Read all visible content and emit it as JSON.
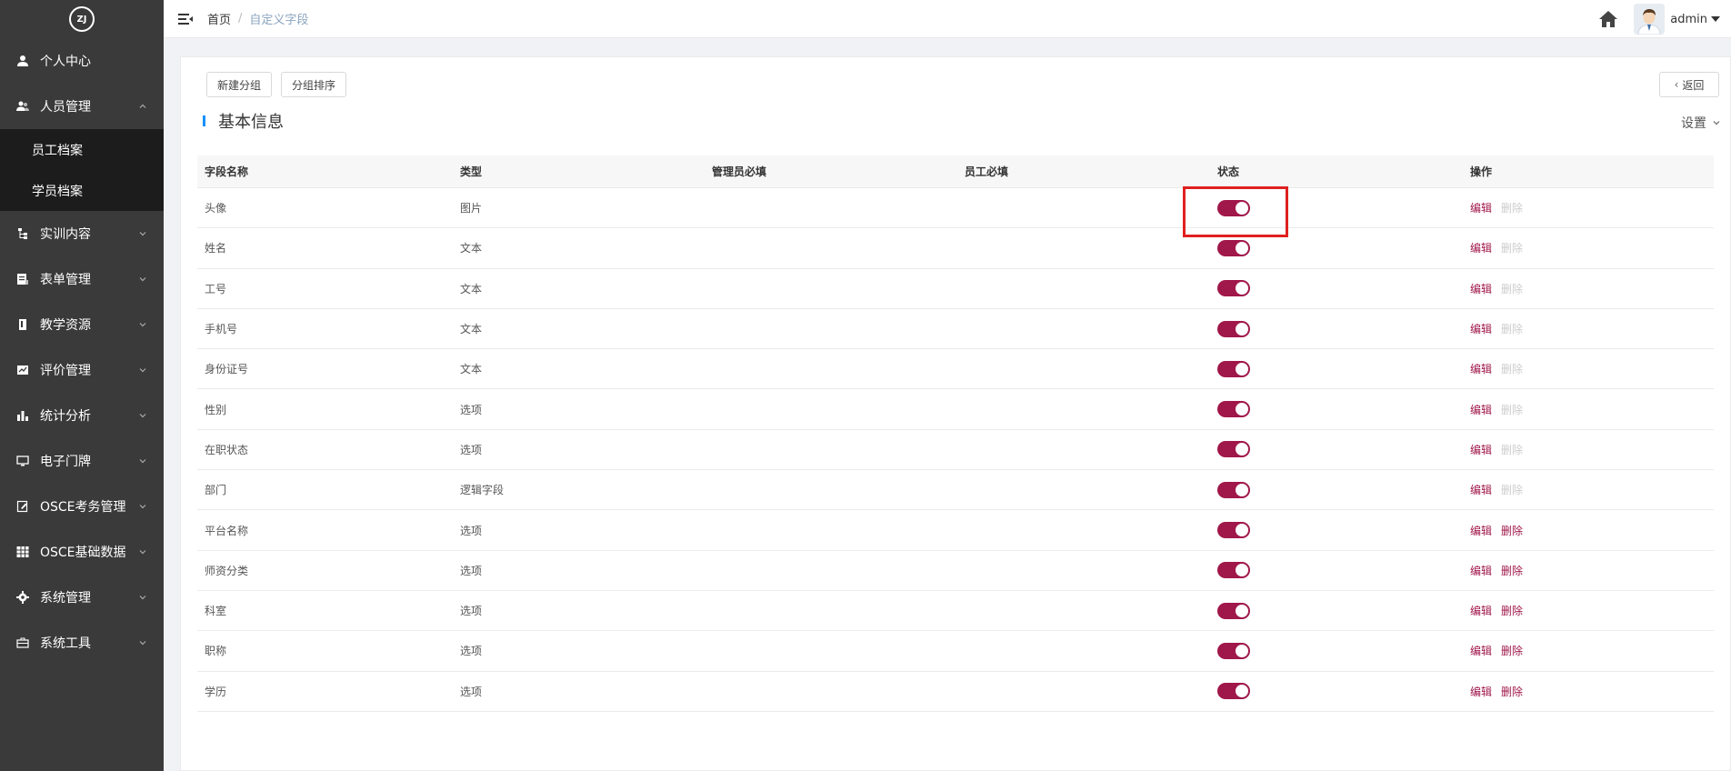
{
  "sidebar": {
    "logo": "ZJ",
    "items": [
      {
        "label": "个人中心",
        "icon": "user-icon",
        "has_children": false
      },
      {
        "label": "人员管理",
        "icon": "users-icon",
        "has_children": true,
        "expanded": true,
        "children": [
          {
            "label": "员工档案"
          },
          {
            "label": "学员档案"
          }
        ]
      },
      {
        "label": "实训内容",
        "icon": "tree-icon",
        "has_children": true
      },
      {
        "label": "表单管理",
        "icon": "form-icon",
        "has_children": true
      },
      {
        "label": "教学资源",
        "icon": "book-icon",
        "has_children": true
      },
      {
        "label": "评价管理",
        "icon": "rating-icon",
        "has_children": true
      },
      {
        "label": "统计分析",
        "icon": "bar-chart-icon",
        "has_children": true
      },
      {
        "label": "电子门牌",
        "icon": "monitor-icon",
        "has_children": true
      },
      {
        "label": "OSCE考务管理",
        "icon": "edit-icon",
        "has_children": true
      },
      {
        "label": "OSCE基础数据",
        "icon": "grid-icon",
        "has_children": true
      },
      {
        "label": "系统管理",
        "icon": "gear-icon",
        "has_children": true
      },
      {
        "label": "系统工具",
        "icon": "toolbox-icon",
        "has_children": true
      }
    ]
  },
  "header": {
    "breadcrumb": {
      "home": "首页",
      "separator": "/",
      "current": "自定义字段"
    },
    "username": "admin"
  },
  "toolbar": {
    "new_group": "新建分组",
    "sort_group": "分组排序",
    "back": "返回"
  },
  "section": {
    "title": "基本信息",
    "settings": "设置"
  },
  "table": {
    "headers": [
      "字段名称",
      "类型",
      "管理员必填",
      "员工必填",
      "状态",
      "操作"
    ],
    "edit_label": "编辑",
    "delete_label": "删除",
    "rows": [
      {
        "name": "头像",
        "type": "图片",
        "admin_required": "",
        "staff_required": "",
        "enabled": true,
        "deletable": false
      },
      {
        "name": "姓名",
        "type": "文本",
        "admin_required": "",
        "staff_required": "",
        "enabled": true,
        "deletable": false
      },
      {
        "name": "工号",
        "type": "文本",
        "admin_required": "",
        "staff_required": "",
        "enabled": true,
        "deletable": false
      },
      {
        "name": "手机号",
        "type": "文本",
        "admin_required": "",
        "staff_required": "",
        "enabled": true,
        "deletable": false
      },
      {
        "name": "身份证号",
        "type": "文本",
        "admin_required": "",
        "staff_required": "",
        "enabled": true,
        "deletable": false
      },
      {
        "name": "性别",
        "type": "选项",
        "admin_required": "",
        "staff_required": "",
        "enabled": true,
        "deletable": false
      },
      {
        "name": "在职状态",
        "type": "选项",
        "admin_required": "",
        "staff_required": "",
        "enabled": true,
        "deletable": false
      },
      {
        "name": "部门",
        "type": "逻辑字段",
        "admin_required": "",
        "staff_required": "",
        "enabled": true,
        "deletable": false
      },
      {
        "name": "平台名称",
        "type": "选项",
        "admin_required": "",
        "staff_required": "",
        "enabled": true,
        "deletable": true
      },
      {
        "name": "师资分类",
        "type": "选项",
        "admin_required": "",
        "staff_required": "",
        "enabled": true,
        "deletable": true
      },
      {
        "name": "科室",
        "type": "选项",
        "admin_required": "",
        "staff_required": "",
        "enabled": true,
        "deletable": true
      },
      {
        "name": "职称",
        "type": "选项",
        "admin_required": "",
        "staff_required": "",
        "enabled": true,
        "deletable": true
      },
      {
        "name": "学历",
        "type": "选项",
        "admin_required": "",
        "staff_required": "",
        "enabled": true,
        "deletable": true
      }
    ]
  },
  "colors": {
    "accent": "#a0174a",
    "sidebar_bg": "#3a3a3a",
    "submenu_bg": "#1c1c1c",
    "section_bar": "#1890ff",
    "highlight": "#e02020"
  }
}
